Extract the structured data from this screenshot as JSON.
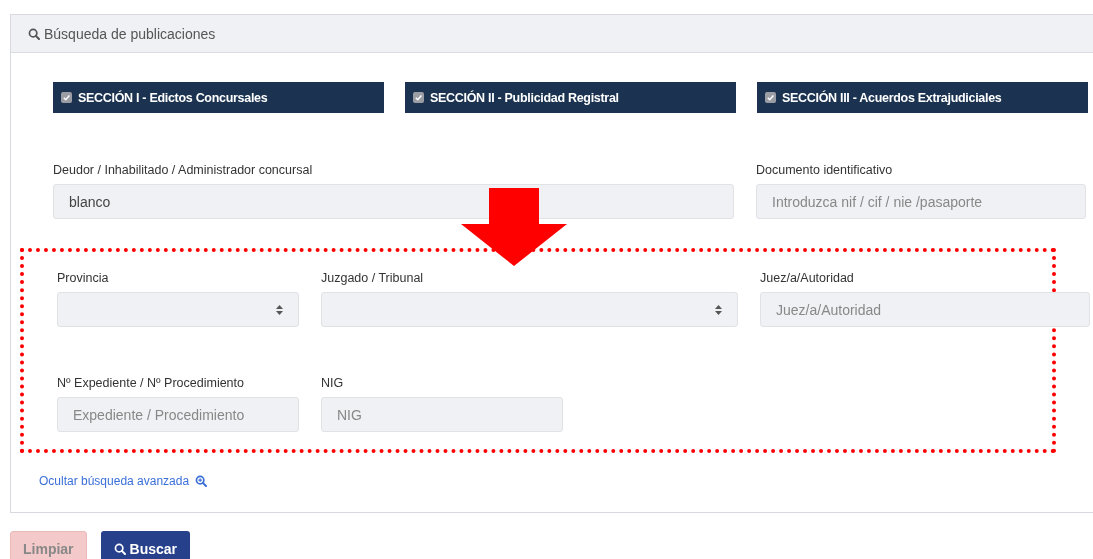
{
  "panel": {
    "title": "Búsqueda de publicaciones"
  },
  "sections": [
    {
      "label": "SECCIÓN I - Edictos Concursales",
      "checked": true
    },
    {
      "label": "SECCIÓN II - Publicidad Registral",
      "checked": true
    },
    {
      "label": "SECCIÓN III - Acuerdos Extrajudiciales",
      "checked": true
    }
  ],
  "basic_fields": [
    {
      "kind": "text",
      "label": "Deudor / Inhabilitado / Administrador concursal",
      "value": "blanco"
    },
    {
      "kind": "text",
      "label": "Documento identificativo",
      "placeholder": "Introduzca nif / cif / nie /pasaporte"
    }
  ],
  "advanced_rows": [
    [
      {
        "kind": "select",
        "label": "Provincia"
      },
      {
        "kind": "select",
        "label": "Juzgado / Tribunal"
      },
      {
        "kind": "text",
        "label": "Juez/a/Autoridad",
        "placeholder": "Juez/a/Autoridad"
      }
    ],
    [
      {
        "kind": "text",
        "label": "Nº Expediente / Nº Procedimiento",
        "placeholder": "Expediente / Procedimiento"
      },
      {
        "kind": "text",
        "label": "NIG",
        "placeholder": "NIG"
      }
    ]
  ],
  "toggle_link": "Ocultar búsqueda avanzada",
  "buttons": [
    {
      "kind": "clear",
      "label": "Limpiar"
    },
    {
      "kind": "search",
      "label": "Buscar"
    }
  ]
}
